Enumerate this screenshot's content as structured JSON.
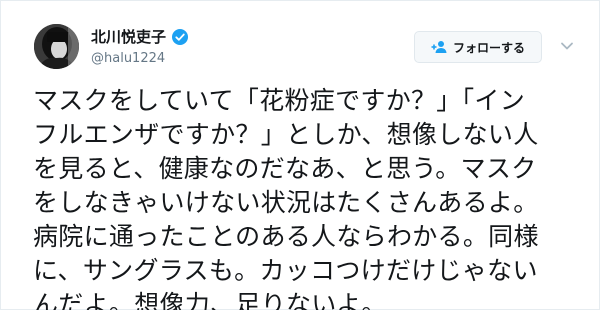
{
  "user": {
    "display_name": "北川悦吏子",
    "handle": "@halu1224",
    "verified": true
  },
  "follow_button": {
    "label": "フォローする"
  },
  "tweet": {
    "lines": [
      "マスクをしていて「花粉症ですか？」「イン",
      "フルエンザですか？」としか、想像しない人",
      "を見ると、健康なのだなあ、と思う。マスク",
      "をしなきゃいけない状況はたくさんあるよ。",
      "病院に通ったことのある人ならわかる。同様",
      "に、サングラスも。カッコつけだけじゃない",
      "んだよ。想像力、足りないよ。"
    ]
  },
  "colors": {
    "verified_badge": "#1da1f2",
    "handle_gray": "#657786",
    "text": "#14171a",
    "follow_icon": "#1da1f2"
  },
  "icons": {
    "verified": "verified-badge-icon",
    "follow": "person-add-icon",
    "menu": "chevron-down-icon"
  }
}
